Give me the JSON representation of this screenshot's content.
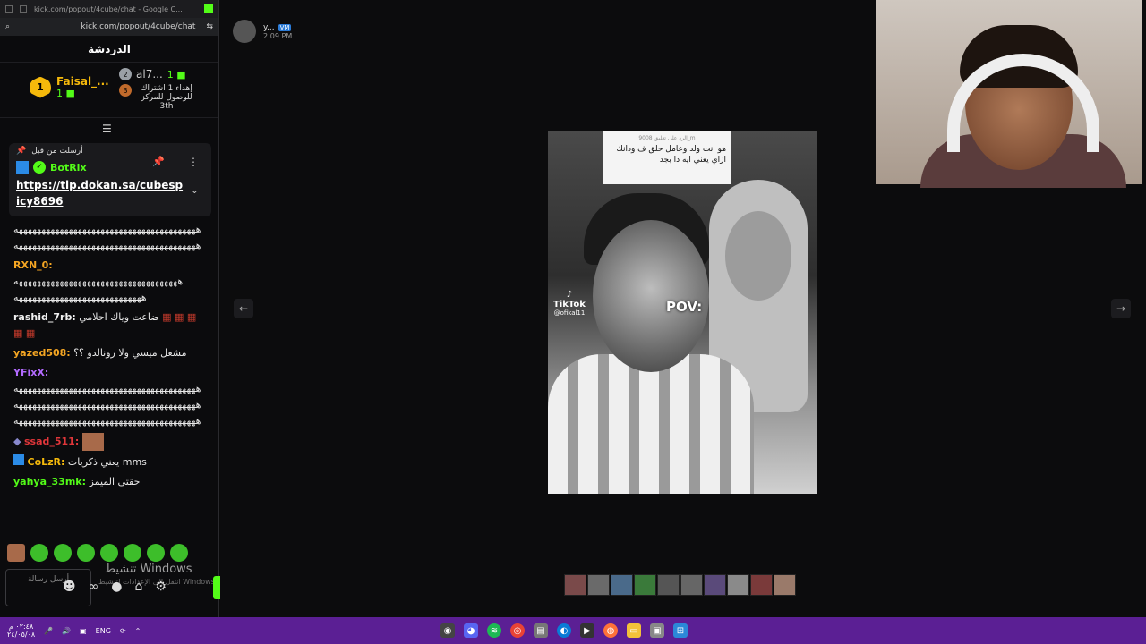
{
  "browser": {
    "title": "kick.com/popout/4cube/chat - Google C...",
    "url": "kick.com/popout/4cube/chat"
  },
  "chat": {
    "header": "الدردشة",
    "leaderboard": {
      "first": {
        "rank": "1",
        "name": "Faisal_...",
        "count": "1"
      },
      "second": {
        "rank": "2",
        "name": "al7...",
        "count": "1"
      },
      "gift_text": "إهداء 1 اشتراك للوصول للمركز 3th",
      "third_rank": "3"
    },
    "pinned": {
      "sent_by": "أرسلت من قبل",
      "user": "BotRix",
      "link": "https://tip.dokan.sa/cubespicy8696"
    },
    "messages": [
      {
        "user": "",
        "text": "ههههههههههههههههههههههههههههههههههههههههه ههههههههههههههههههههههههههههههههههههههههه",
        "color": "#e8e8e8"
      },
      {
        "user": "RXN_0:",
        "text": "ههههههههههههههههههههههههههههههههههههه ههههههههههههههههههههههههههههه",
        "color": "#f5a623"
      },
      {
        "user": "rashid_7rb:",
        "text": "ضاعت وياك احلامي",
        "color": "#f0f0f0"
      },
      {
        "user": "yazed508:",
        "text": "مشعل ميسي ولا رونالدو ؟؟",
        "color": "#f5a623"
      },
      {
        "user": "YFixX:",
        "text": "ههههههههههههههههههههههههههههههههههههههههه ههههههههههههههههههههههههههههههههههههههههه ههههههههههههههههههههههههههههههههههههههههه",
        "color": "#b36bff"
      },
      {
        "user": "ssad_511:",
        "text": "",
        "color": "#e0363a"
      },
      {
        "user": "CoLzR:",
        "text": "يعني ذكريات mms",
        "color": "#f5b90b"
      },
      {
        "user": "yahya_33mk:",
        "text": "حقتي الميمز",
        "color": "#53fc18"
      }
    ],
    "input_placeholder": "أرسل رسالة",
    "windows_activation": "تنشيط Windows",
    "windows_activation_sub": "انتقل إلى الإعدادات لتنشيط Windows."
  },
  "viewer": {
    "poster_name": "y...",
    "poster_role": "VM",
    "poster_time": "2:09 PM",
    "media": {
      "caption_reply": "الرد على تعليق 9008_m",
      "caption": "هو انت ولد وعامل حلق ف ودانك ازاي يعني ايه دا بجد",
      "tiktok_label": "TikTok",
      "tiktok_user": "@ofikal11",
      "pov": "POV:"
    },
    "prev_arrow": "←",
    "next_arrow": "→"
  },
  "taskbar": {
    "time": "٠٢:٤٨ م",
    "date": "٢٤/٠٥/٠٨",
    "lang": "ENG"
  }
}
